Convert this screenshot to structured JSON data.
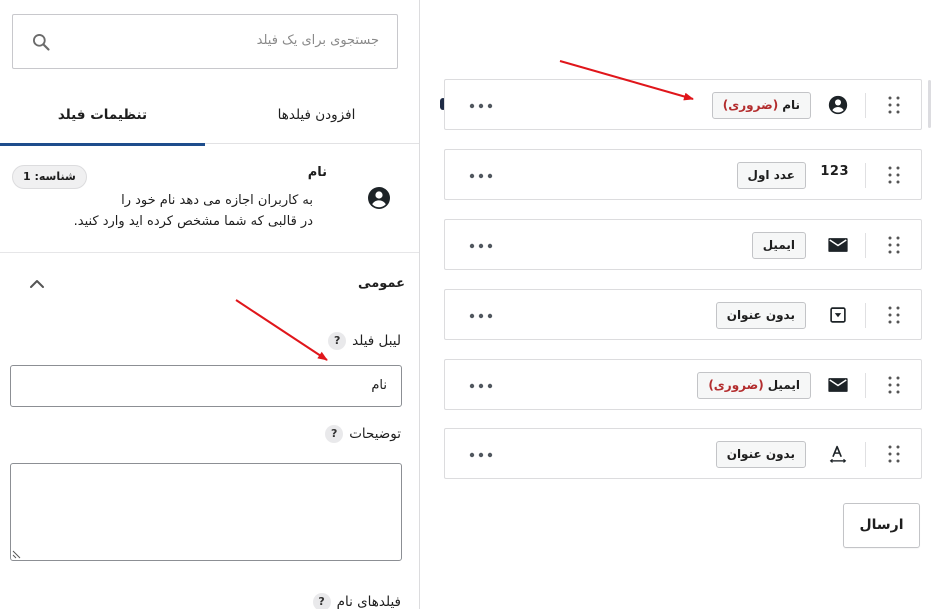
{
  "search": {
    "placeholder": "جستجوی برای یک فیلد",
    "icon": "search-icon"
  },
  "tabs": [
    {
      "label": "افزودن فیلدها",
      "active": false
    },
    {
      "label": "تنظیمات فیلد",
      "active": true
    }
  ],
  "field_info": {
    "title": "نام",
    "desc_line1": "به کاربران اجازه می دهد نام خود را",
    "desc_line2": "در قالبی که شما مشخص کرده اید وارد کنید.",
    "id_badge": "شناسه: 1",
    "icon": "user-circle-icon"
  },
  "general": {
    "title": "عمومی",
    "field_label": {
      "label": "لیبل فیلد",
      "help": "?",
      "value": "نام"
    },
    "description": {
      "label": "توضیحات",
      "help": "?",
      "value": ""
    },
    "name_fields": {
      "label": "فیلدهای نام",
      "help": "?"
    }
  },
  "form_fields": [
    {
      "icon": "user-circle-icon",
      "label": "نام",
      "required_text": "(ضروری)",
      "selected": true
    },
    {
      "icon_text": "123",
      "label": "عدد اول",
      "required_text": ""
    },
    {
      "icon": "envelope-icon",
      "label": "ایمیل",
      "required_text": ""
    },
    {
      "icon": "dropdown-icon",
      "label": "بدون عنوان",
      "required_text": ""
    },
    {
      "icon": "envelope-icon",
      "label": "ایمیل",
      "required_text": "(ضروری)"
    },
    {
      "icon": "text-format-icon",
      "label": "بدون عنوان",
      "required_text": ""
    }
  ],
  "submit": {
    "label": "ارسال"
  },
  "colors": {
    "accent": "#1e4d8c",
    "required": "#b32d2e",
    "annotation_arrow": "#e0161b",
    "text": "#1e1e1e"
  }
}
